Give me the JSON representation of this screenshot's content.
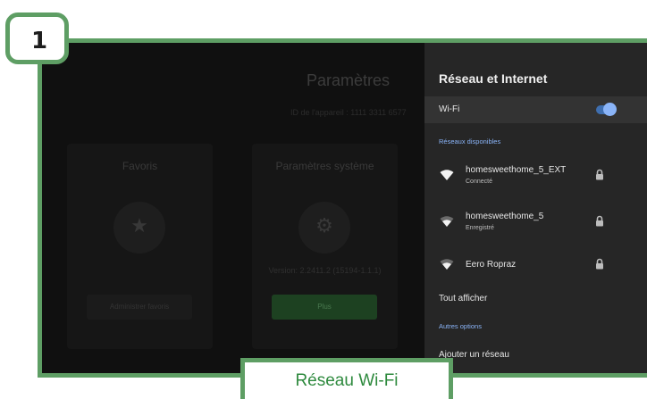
{
  "step_number": "1",
  "caption": "Réseau Wi-Fi",
  "background_screen": {
    "title": "Paramètres",
    "device_id": "ID de l'appareil : 1111 3311 6577",
    "cards": [
      {
        "title": "Favoris",
        "icon": "star-icon",
        "button": "Administrer favoris"
      },
      {
        "title": "Paramètres système",
        "icon": "gear-icon",
        "version": "Version: 2.2411.2 (15194-1.1.1)",
        "button": "Plus"
      }
    ]
  },
  "panel": {
    "title": "Réseau et Internet",
    "wifi_label": "Wi-Fi",
    "wifi_enabled": true,
    "available_header": "Réseaux disponibles",
    "networks": [
      {
        "name": "homesweethome_5_EXT",
        "status": "Connecté",
        "signal": "full",
        "secured": true
      },
      {
        "name": "homesweethome_5",
        "status": "Enregistré",
        "signal": "medium",
        "secured": true
      },
      {
        "name": "Eero Ropraz",
        "status": "",
        "signal": "medium",
        "secured": true
      }
    ],
    "see_all": "Tout afficher",
    "other_header": "Autres options",
    "add_network": "Ajouter un réseau"
  },
  "colors": {
    "frame_green": "#5e9e64",
    "caption_green": "#2e8a3e",
    "accent_blue": "#8ab4f8"
  }
}
